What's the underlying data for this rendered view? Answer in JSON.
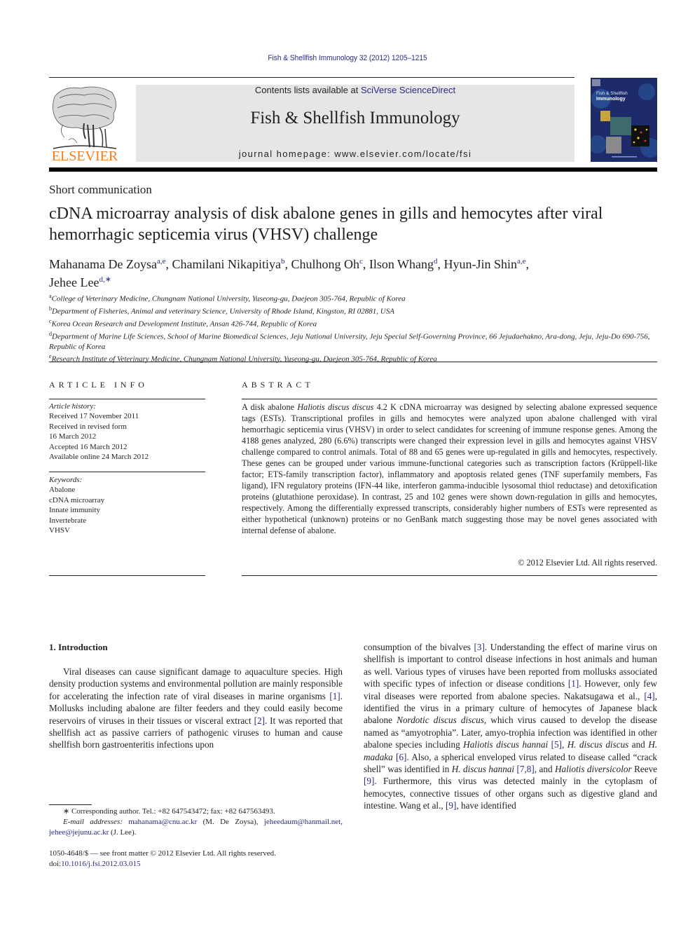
{
  "running_header": "Fish & Shellfish Immunology 32 (2012) 1205–1215",
  "masthead": {
    "publisher_logo_text": "ELSEVIER",
    "contents_prefix": "Contents lists available at ",
    "contents_link": "SciVerse ScienceDirect",
    "journal_name": "Fish & Shellfish Immunology",
    "homepage": "journal homepage: www.elsevier.com/locate/fsi",
    "cover_title_line1": "Fish & Shellfish",
    "cover_title_line2": "Immunology"
  },
  "article": {
    "type": "Short communication",
    "title": "cDNA microarray analysis of disk abalone genes in gills and hemocytes after viral hemorrhagic septicemia virus (VHSV) challenge",
    "authors": [
      {
        "name": "Mahanama De Zoysa",
        "sup": "a,e",
        "sep": ", "
      },
      {
        "name": "Chamilani Nikapitiya",
        "sup": "b",
        "sep": ", "
      },
      {
        "name": "Chulhong Oh",
        "sup": "c",
        "sep": ", "
      },
      {
        "name": "Ilson Whang",
        "sup": "d",
        "sep": ", "
      },
      {
        "name": "Hyun-Jin Shin",
        "sup": "a,e",
        "sep": ","
      },
      {
        "name": "Jehee Lee",
        "sup": "d,∗",
        "sep": ""
      }
    ],
    "affiliations": [
      {
        "key": "a",
        "text": "College of Veterinary Medicine, Chungnam National University, Yuseong-gu, Daejeon 305-764, Republic of Korea"
      },
      {
        "key": "b",
        "text": "Department of Fisheries, Animal and veterinary Science, University of Rhode Island, Kingston, RI 02881, USA"
      },
      {
        "key": "c",
        "text": "Korea Ocean Research and Development Institute, Ansan 426-744, Republic of Korea"
      },
      {
        "key": "d",
        "text": "Department of Marine Life Sciences, School of Marine Biomedical Sciences, Jeju National University, Jeju Special Self-Governing Province, 66 Jejudaehakno, Ara-dong, Jeju, Jeju-Do 690-756, Republic of Korea"
      },
      {
        "key": "e",
        "text": "Research Institute of Veterinary Medicine, Chungnam National University, Yuseong-gu, Daejeon 305-764, Republic of Korea"
      }
    ]
  },
  "article_info": {
    "heading": "ARTICLE INFO",
    "history_label": "Article history:",
    "history": [
      "Received 17 November 2011",
      "Received in revised form",
      "16 March 2012",
      "Accepted 16 March 2012",
      "Available online 24 March 2012"
    ],
    "keywords_label": "Keywords:",
    "keywords": [
      "Abalone",
      "cDNA microarray",
      "Innate immunity",
      "Invertebrate",
      "VHSV"
    ]
  },
  "abstract": {
    "heading": "ABSTRACT",
    "p1": "A disk abalone ",
    "species": "Haliotis discus discus",
    "p2": " 4.2 K cDNA microarray was designed by selecting abalone expressed sequence tags (ESTs). Transcriptional profiles in gills and hemocytes were analyzed upon abalone challenged with viral hemorrhagic septicemia virus (VHSV) in order to select candidates for screening of immune response genes. Among the 4188 genes analyzed, 280 (6.6%) transcripts were changed their expression level in gills and hemocytes against VHSV challenge compared to control animals. Total of 88 and 65 genes were up-regulated in gills and hemocytes, respectively. These genes can be grouped under various immune-functional categories such as transcription factors (Krüppell-like factor; ETS-family transcription factor), inflammatory and apoptosis related genes (TNF superfamily members, Fas ligand), IFN regulatory proteins (IFN-44 like, interferon gamma-inducible lysosomal thiol reductase) and detoxification proteins (glutathione peroxidase). In contrast, 25 and 102 genes were shown down-regulation in gills and hemocytes, respectively. Among the differentially expressed transcripts, considerably higher numbers of ESTs were represented as either hypothetical (unknown) proteins or no GenBank match suggesting those may be novel genes associated with internal defense of abalone.",
    "copyright": "© 2012 Elsevier Ltd. All rights reserved."
  },
  "introduction": {
    "heading": "1.  Introduction",
    "col1": [
      {
        "t": "Viral diseases can cause significant damage to aquaculture species. High density production systems and environmental pollution are mainly responsible for accelerating the infection rate of viral diseases in marine organisms "
      },
      {
        "c": "[1]"
      },
      {
        "t": ". Mollusks including abalone are filter feeders and they could easily become reservoirs of viruses in their tissues or visceral extract "
      },
      {
        "c": "[2]"
      },
      {
        "t": ". It was reported that shellfish act as passive carriers of pathogenic viruses to human and cause shellfish born gastroenteritis infections upon"
      }
    ],
    "col2": [
      {
        "t": "consumption of the bivalves "
      },
      {
        "c": "[3]"
      },
      {
        "t": ". Understanding the effect of marine virus on shellfish is important to control disease infections in host animals and human as well. Various types of viruses have been reported from mollusks associated with specific types of infection or disease conditions "
      },
      {
        "c": "[1]"
      },
      {
        "t": ". However, only few viral diseases were reported from abalone species. Nakatsugawa et al., "
      },
      {
        "c": "[4]"
      },
      {
        "t": ", identified the virus in a primary culture of hemocytes of Japanese black abalone "
      },
      {
        "i": "Nordotic discus discus,"
      },
      {
        "t": " which virus caused to develop the disease named as “amyotrophia”. Later, amyo-trophia infection was identified in other abalone species including "
      },
      {
        "i": "Haliotis discus hannai"
      },
      {
        "t": " "
      },
      {
        "c": "[5]"
      },
      {
        "t": ", "
      },
      {
        "i": "H. discus discus"
      },
      {
        "t": " and "
      },
      {
        "i": "H. madaka"
      },
      {
        "t": " "
      },
      {
        "c": "[6]"
      },
      {
        "t": ". Also, a spherical enveloped virus related to disease called “crack shell” was identified in "
      },
      {
        "i": "H. discus hannai"
      },
      {
        "t": " "
      },
      {
        "c": "[7,8]"
      },
      {
        "t": ", and "
      },
      {
        "i": "Haliotis diversicolor"
      },
      {
        "t": " Reeve "
      },
      {
        "c": "[9]"
      },
      {
        "t": ". Furthermore, this virus was detected mainly in the cytoplasm of hemocytes, connective tissues of other organs such as digestive gland and intestine. Wang et al., "
      },
      {
        "c": "[9]"
      },
      {
        "t": ", have identified"
      }
    ]
  },
  "footnote": {
    "corresponding": "∗  Corresponding author. Tel.: +82 647543472; fax: +82 647563493.",
    "email_label": "E-mail addresses:",
    "email1": "mahanama@cnu.ac.kr",
    "email1_owner": " (M. De Zoysa), ",
    "email2": "jeheedaum@hanmail.net",
    "email_sep": ", ",
    "email3": "jehee@jejunu.ac.kr",
    "email3_owner": " (J. Lee)."
  },
  "front_matter": {
    "issn_line": "1050-4648/$ — see front matter © 2012 Elsevier Ltd. All rights reserved.",
    "doi_prefix": "doi:",
    "doi": "10.1016/j.fsi.2012.03.015"
  },
  "colors": {
    "link": "#2a2a86",
    "elsevier_orange": "#f47d20",
    "masthead_gray": "#e6e6e6",
    "cover_blue": "#1d2b6b"
  }
}
